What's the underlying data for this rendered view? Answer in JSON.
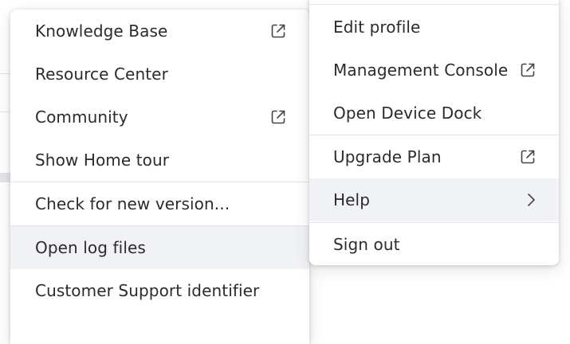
{
  "help_submenu": {
    "items": [
      {
        "label": "Knowledge Base",
        "icon": "external-link-icon"
      },
      {
        "label": "Resource Center"
      },
      {
        "label": "Community",
        "icon": "external-link-icon"
      },
      {
        "label": "Show Home tour"
      },
      {
        "label": "Check for new version..."
      },
      {
        "label": "Open log files"
      },
      {
        "label": "Customer Support identifier"
      }
    ]
  },
  "account_menu": {
    "items": [
      {
        "label": "Edit profile"
      },
      {
        "label": "Management Console",
        "icon": "external-link-icon"
      },
      {
        "label": "Open Device Dock"
      },
      {
        "label": "Upgrade Plan",
        "icon": "external-link-icon"
      },
      {
        "label": "Help",
        "icon": "chevron-right-icon"
      },
      {
        "label": "Sign out"
      }
    ]
  },
  "colors": {
    "menu_background": "#ffffff",
    "hover_background": "#f1f2f6",
    "text": "#2b2b2b",
    "icon": "#444444",
    "divider": "#e4e4e4"
  }
}
